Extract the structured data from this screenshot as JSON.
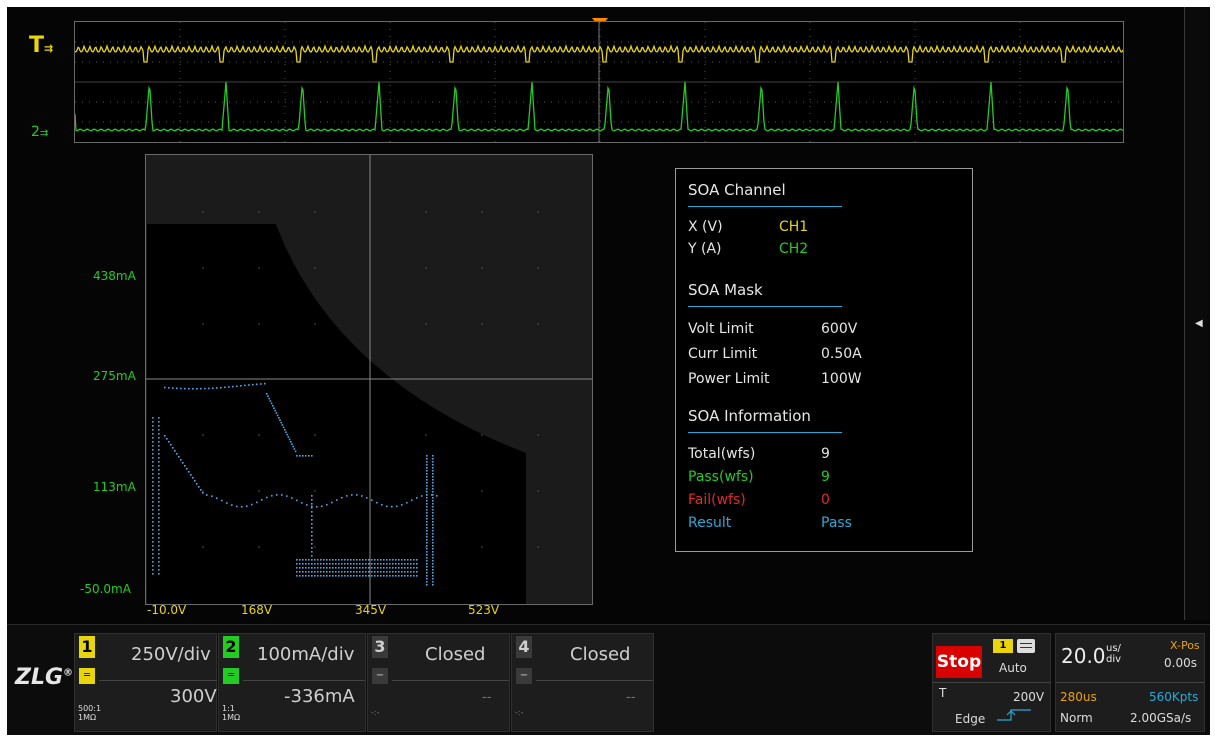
{
  "waveform": {
    "ch1_marker": "T",
    "ch1_color": "#e8d60a",
    "ch2_marker": "2",
    "ch2_color": "#22cc22",
    "trigger_color": "#ff8a00"
  },
  "xy_plot": {
    "y_labels": [
      "438mA",
      "275mA",
      "113mA",
      "-50.0mA"
    ],
    "x_labels": [
      "-10.0V",
      "168V",
      "345V",
      "523V"
    ],
    "trace_color": "#4aa8e8"
  },
  "soa": {
    "channel_title": "SOA Channel",
    "x_label": "X (V)",
    "x_value": "CH1",
    "y_label": "Y (A)",
    "y_value": "CH2",
    "mask_title": "SOA Mask",
    "volt_label": "Volt Limit",
    "volt_value": "600V",
    "curr_label": "Curr Limit",
    "curr_value": "0.50A",
    "power_label": "Power Limit",
    "power_value": "100W",
    "info_title": "SOA Information",
    "total_label": "Total(wfs)",
    "total_value": "9",
    "pass_label": "Pass(wfs)",
    "pass_value": "9",
    "fail_label": "Fail(wfs)",
    "fail_value": "0",
    "result_label": "Result",
    "result_value": "Pass"
  },
  "bottom": {
    "logo": "ZLG",
    "ch1": {
      "num": "1",
      "scale": "250V/div",
      "offset": "300V",
      "probe_ratio": "500:1",
      "impedance": "1MΩ"
    },
    "ch2": {
      "num": "2",
      "scale": "100mA/div",
      "offset": "-336mA",
      "probe_ratio": "1:1",
      "impedance": "1MΩ"
    },
    "ch3": {
      "num": "3",
      "status": "Closed",
      "offset": "--",
      "aux": "-:-"
    },
    "ch4": {
      "num": "4",
      "status": "Closed",
      "offset": "--",
      "aux": "-:-"
    },
    "trigger": {
      "run_state": "Stop",
      "source": "1",
      "mode": "Auto",
      "type_marker": "T",
      "level": "200V",
      "type": "Edge"
    },
    "timebase": {
      "scale_value": "20.0",
      "scale_unit_top": "us/",
      "scale_unit_bottom": "div",
      "xpos_label": "X-Pos",
      "xpos_value": "0.00s",
      "memory_time": "280us",
      "memory_pts": "560Kpts",
      "acq_mode": "Norm",
      "sample_rate": "2.00GSa/s"
    }
  }
}
